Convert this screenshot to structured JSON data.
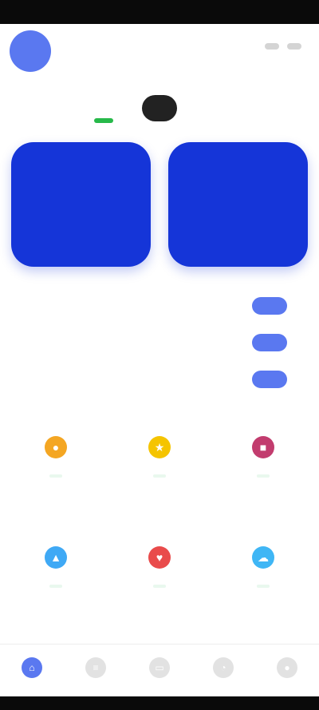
{
  "profile": {
    "initial": ""
  },
  "header": {
    "toggle_label": ""
  },
  "cards": [
    {
      "value": "",
      "label": "",
      "sub": ""
    },
    {
      "value": "",
      "label": "",
      "sub": ""
    }
  ],
  "stats": [
    {
      "label": "",
      "value": "",
      "action": ""
    },
    {
      "label": "",
      "value": "",
      "action": ""
    },
    {
      "label": "",
      "value": "",
      "action": ""
    }
  ],
  "section1": {
    "title": "",
    "tiles": [
      {
        "label": "",
        "tag": "",
        "color": "#f4a623",
        "icon": "coin-icon"
      },
      {
        "label": "",
        "tag": "",
        "color": "#f5c400",
        "icon": "star-icon"
      },
      {
        "label": "",
        "tag": "",
        "color": "#c23c6e",
        "icon": "gift-icon"
      }
    ]
  },
  "section2": {
    "title": "",
    "tiles": [
      {
        "label": "",
        "tag": "",
        "color": "#3fa9f5",
        "icon": "chart-icon"
      },
      {
        "label": "",
        "tag": "",
        "color": "#e94b4b",
        "icon": "heart-icon"
      },
      {
        "label": "",
        "tag": "",
        "color": "#3fb6f5",
        "icon": "cloud-icon"
      }
    ]
  },
  "tabbar": {
    "tabs": [
      {
        "label": "",
        "icon": "home-icon",
        "active": true
      },
      {
        "label": "",
        "icon": "list-icon",
        "active": false
      },
      {
        "label": "",
        "icon": "wallet-icon",
        "active": false
      },
      {
        "label": "",
        "icon": "bell-icon",
        "active": false
      },
      {
        "label": "",
        "icon": "user-icon",
        "active": false
      }
    ]
  },
  "colors": {
    "accent": "#1535d8",
    "avatar": "#5a78f0",
    "success": "#27b94a"
  }
}
